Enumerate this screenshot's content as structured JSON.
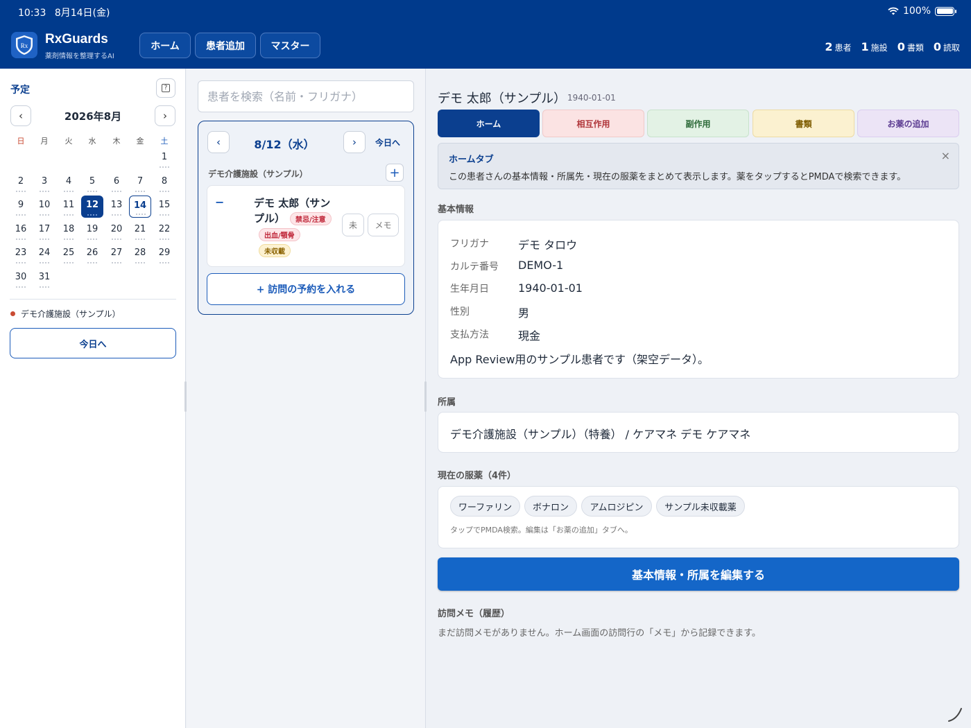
{
  "status_bar": {
    "time": "10:33",
    "date": "8月14日(金)",
    "battery": "100%"
  },
  "header": {
    "app_name": "RxGuards",
    "tagline": "薬剤情報を整理するAI",
    "logo_text": "Rx",
    "nav": [
      "ホーム",
      "患者追加",
      "マスター"
    ],
    "stats": [
      {
        "value": "2",
        "label": "患者"
      },
      {
        "value": "1",
        "label": "施設"
      },
      {
        "value": "0",
        "label": "書類"
      },
      {
        "value": "0",
        "label": "読取"
      }
    ]
  },
  "calendar": {
    "title": "予定",
    "month": "2026年8月",
    "prev": "‹",
    "next": "›",
    "weekdays": [
      "日",
      "月",
      "火",
      "水",
      "木",
      "金",
      "土"
    ],
    "days": [
      "1",
      "2",
      "3",
      "4",
      "5",
      "6",
      "7",
      "8",
      "9",
      "10",
      "11",
      "12",
      "13",
      "14",
      "15",
      "16",
      "17",
      "18",
      "19",
      "20",
      "21",
      "22",
      "23",
      "24",
      "25",
      "26",
      "27",
      "28",
      "29",
      "30",
      "31"
    ],
    "selected_day": "12",
    "today_day": "14",
    "legend_facility": "デモ介護施設（サンプル）",
    "legend_color": "#c94b33",
    "today_button": "今日へ"
  },
  "middle": {
    "search_placeholder": "患者を検索（名前・フリガナ）",
    "day_prev": "‹",
    "day_next": "›",
    "day_label": "8/12（水）",
    "today_link": "今日へ",
    "facility": "デモ介護施設（サンプル）",
    "add_symbol": "+",
    "patient": {
      "collapse": "−",
      "name": "デモ 太郎（サンプル）",
      "tags": [
        "禁忌/注意",
        "出血/顎骨",
        "未収載"
      ],
      "status_button": "未",
      "memo_button": "メモ"
    },
    "reserve_button": "+ 訪問の予約を入れる"
  },
  "patient": {
    "name": "デモ 太郎（サンプル）",
    "dob_short": "1940-01-01",
    "tabs": [
      "ホーム",
      "相互作用",
      "副作用",
      "書類",
      "お薬の追加"
    ],
    "info_title": "ホームタブ",
    "info_text": "この患者さんの基本情報・所属先・現在の服薬をまとめて表示します。薬をタップするとPMDAで検索できます。",
    "close": "×",
    "basic_label": "基本情報",
    "fields": [
      {
        "label": "フリガナ",
        "value": "デモ タロウ"
      },
      {
        "label": "カルテ番号",
        "value": "DEMO-1"
      },
      {
        "label": "生年月日",
        "value": "1940-01-01"
      },
      {
        "label": "性別",
        "value": "男"
      },
      {
        "label": "支払方法",
        "value": "現金"
      }
    ],
    "note": "App Review用のサンプル患者です（架空データ）。",
    "affiliation_label": "所属",
    "affiliation": "デモ介護施設（サンプル）（特養） / ケアマネ デモ ケアマネ",
    "meds_label": "現在の服薬（4件）",
    "meds": [
      "ワーファリン",
      "ボナロン",
      "アムロジピン",
      "サンプル未収載薬"
    ],
    "meds_hint": "タップでPMDA検索。編集は「お薬の追加」タブへ。",
    "edit_button": "基本情報・所属を編集する",
    "memo_label": "訪問メモ（履歴）",
    "memo_empty": "まだ訪問メモがありません。ホーム画面の訪問行の「メモ」から記録できます。"
  },
  "colors": {
    "header": "#003a8c",
    "primary": "#0b3f8f",
    "button_blue": "#1466c8"
  }
}
